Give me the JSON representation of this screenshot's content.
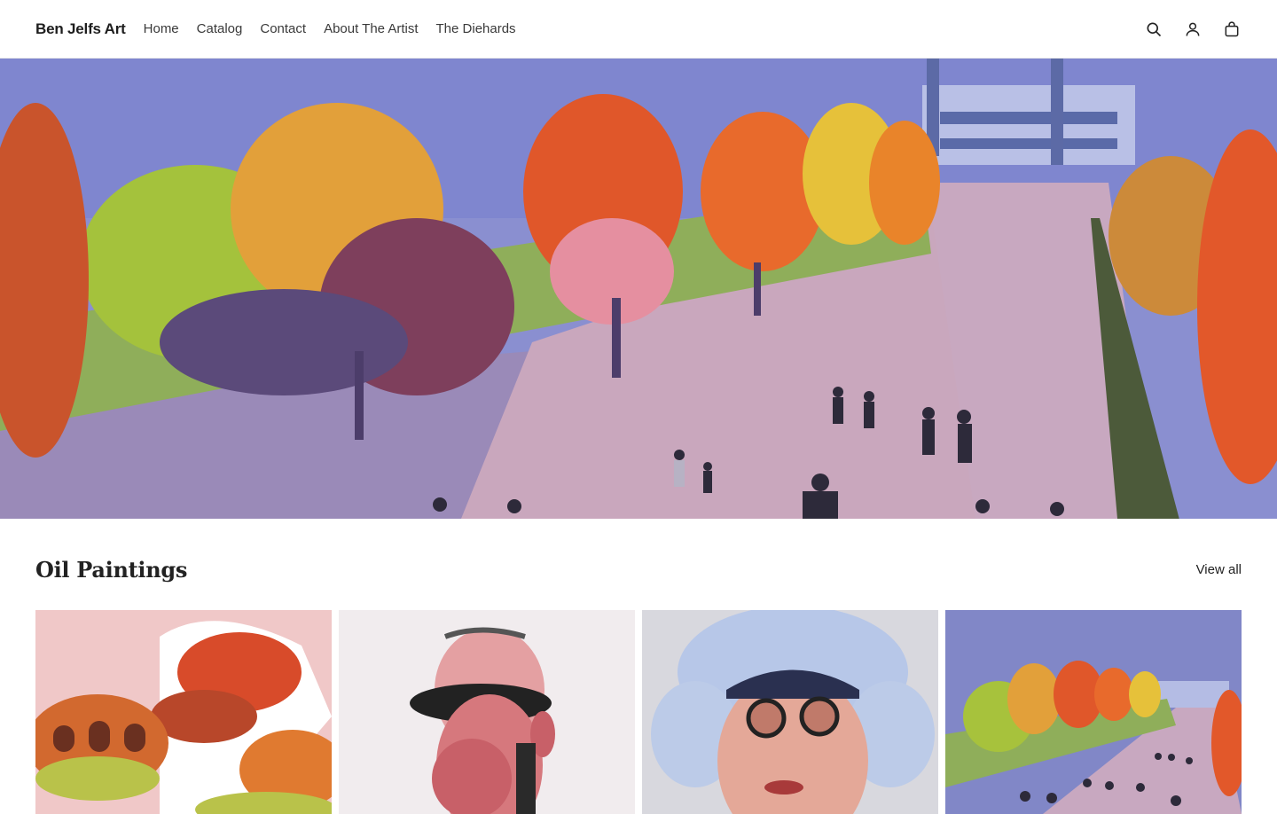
{
  "header": {
    "brand": "Ben Jelfs Art",
    "nav": [
      "Home",
      "Catalog",
      "Contact",
      "About The Artist",
      "The Diehards"
    ],
    "icons": [
      "search-icon",
      "account-icon",
      "cart-icon"
    ]
  },
  "hero": {
    "image": "autumn-park-painting"
  },
  "collection": {
    "title": "Oil Paintings",
    "view_all": "View all",
    "items": [
      {
        "image": "stadium-food-painting"
      },
      {
        "image": "caricature-sunglasses-painting"
      },
      {
        "image": "caricature-grey-hair-painting"
      },
      {
        "image": "autumn-park-painting"
      }
    ]
  },
  "colors": {
    "text": "#222222",
    "accent": "#1e1e1e",
    "background": "#ffffff"
  }
}
